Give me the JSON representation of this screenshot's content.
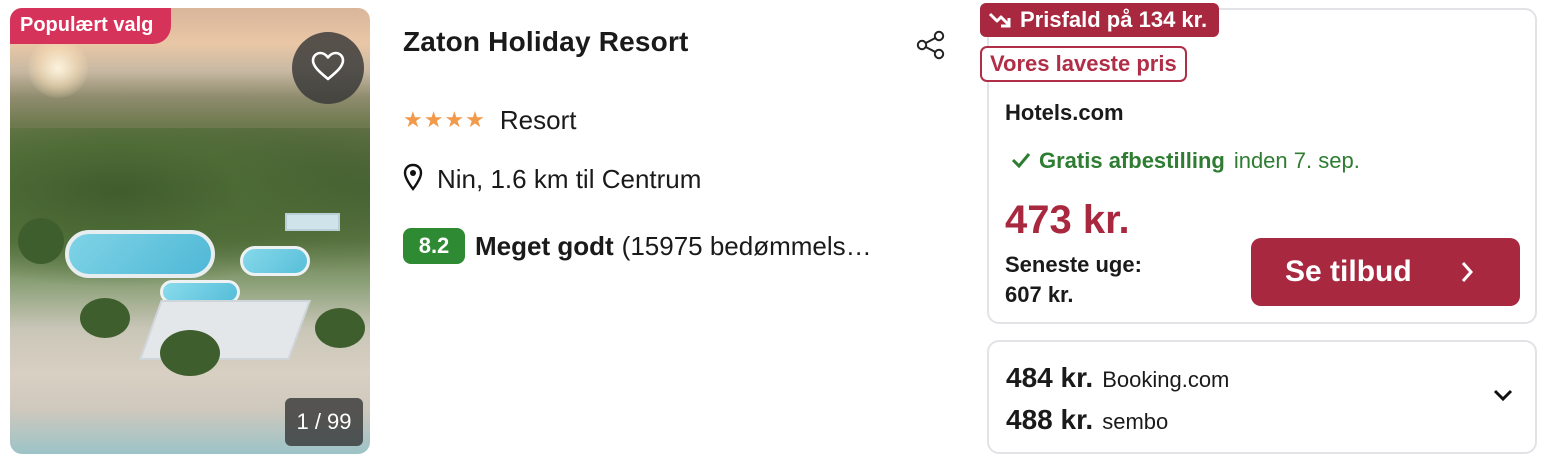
{
  "listing": {
    "badge": "Populært valg",
    "image_counter": "1 / 99",
    "title": "Zaton Holiday Resort",
    "stars": "★★★★",
    "type": "Resort",
    "location": "Nin, 1.6 km til Centrum",
    "rating": {
      "score": "8.2",
      "label": "Meget godt",
      "reviews": "(15975 bedømmels…"
    }
  },
  "deal": {
    "price_drop": "Prisfald på 134 kr.",
    "lowest_tag": "Vores laveste pris",
    "provider": "Hotels.com",
    "free_cancel": "Gratis afbestilling",
    "cancel_until": "inden 7. sep.",
    "price": "473 kr.",
    "last_week_label": "Seneste uge:",
    "last_week_price": "607 kr.",
    "cta": "Se tilbud"
  },
  "other_offers": [
    {
      "price": "484 kr.",
      "provider": "Booking.com"
    },
    {
      "price": "488 kr.",
      "provider": "sembo"
    }
  ],
  "colors": {
    "accent": "#a8283f",
    "badge": "#d6335a",
    "rating_green": "#2e8b34",
    "cancel_green": "#2e7d32",
    "stars": "#f2994a"
  },
  "icons": [
    "heart-icon",
    "share-icon",
    "location-pin-icon",
    "trend-down-icon",
    "check-icon",
    "chevron-right-icon",
    "chevron-down-icon"
  ]
}
